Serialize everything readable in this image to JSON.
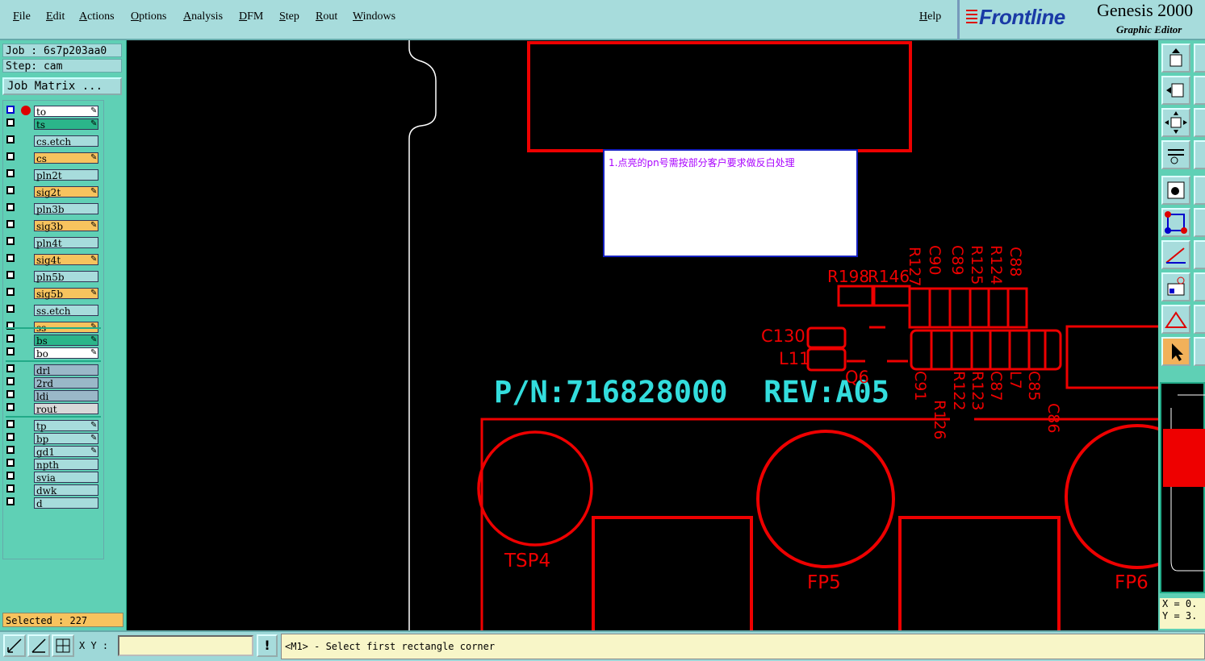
{
  "menu": {
    "items": [
      "File",
      "Edit",
      "Actions",
      "Options",
      "Analysis",
      "DFM",
      "Step",
      "Rout",
      "Windows"
    ],
    "help": "Help"
  },
  "brand": {
    "logo": "Frontline",
    "product": "Genesis 2000",
    "subtitle": "Graphic Editor"
  },
  "job": {
    "job": "Job  :  6s7p203aa0",
    "step": "Step: cam",
    "matrix_button": "Job Matrix ..."
  },
  "layers": [
    {
      "name": "to",
      "color": "#ffffff",
      "pen": true
    },
    {
      "name": "ts",
      "color": "#2bb58a",
      "pen": true
    },
    {
      "name": "cs.etch",
      "color": "#a7dcdc",
      "pen": false
    },
    {
      "name": "cs",
      "color": "#f7c35e",
      "pen": true
    },
    {
      "name": "pln2t",
      "color": "#a7dcdc",
      "pen": false
    },
    {
      "name": "sig2t",
      "color": "#f7c35e",
      "pen": true
    },
    {
      "name": "pln3b",
      "color": "#a7dcdc",
      "pen": false
    },
    {
      "name": "sig3b",
      "color": "#f7c35e",
      "pen": true
    },
    {
      "name": "pln4t",
      "color": "#a7dcdc",
      "pen": false
    },
    {
      "name": "sig4t",
      "color": "#f7c35e",
      "pen": true
    },
    {
      "name": "pln5b",
      "color": "#a7dcdc",
      "pen": false
    },
    {
      "name": "sig5b",
      "color": "#f7c35e",
      "pen": true
    },
    {
      "name": "ss.etch",
      "color": "#a7dcdc",
      "pen": false
    },
    {
      "name": "ss",
      "color": "#f7c35e",
      "pen": true
    },
    {
      "name": "bs",
      "color": "#2bb58a",
      "pen": true
    },
    {
      "name": "bo",
      "color": "#ffffff",
      "pen": true
    },
    {
      "name": "drl",
      "color": "#9ab8c8",
      "pen": false
    },
    {
      "name": "2rd",
      "color": "#9ab8c8",
      "pen": false
    },
    {
      "name": "ldi",
      "color": "#9ab8c8",
      "pen": false
    },
    {
      "name": "rout",
      "color": "#d8d8d8",
      "pen": false
    },
    {
      "name": "tp",
      "color": "#a7dcdc",
      "pen": true
    },
    {
      "name": "bp",
      "color": "#a7dcdc",
      "pen": true
    },
    {
      "name": "gd1",
      "color": "#a7dcdc",
      "pen": true
    },
    {
      "name": "npth",
      "color": "#a7dcdc",
      "pen": false
    },
    {
      "name": "svia",
      "color": "#a7dcdc",
      "pen": false
    },
    {
      "name": "dwk",
      "color": "#a7dcdc",
      "pen": false
    },
    {
      "name": "d",
      "color": "#a7dcdc",
      "pen": false
    }
  ],
  "selected": "Selected : 227",
  "canvas": {
    "note": "1.点亮的pn号需按部分客户要求做反白处理",
    "pn_text": "P/N:716828000  REV:A05",
    "labels": [
      "R198",
      "R146",
      "C130",
      "L11",
      "Q6",
      "TSP4",
      "FP5",
      "FP6"
    ],
    "vertical_labels_top": [
      "R127",
      "C90",
      "C89",
      "R125",
      "R124",
      "C88"
    ],
    "vertical_labels_bottom": [
      "C91",
      "R126",
      "R122",
      "R123",
      "C87",
      "L7",
      "C85",
      "C86"
    ]
  },
  "xy_readout": {
    "x": "X = 0.",
    "y": "Y = 3."
  },
  "statusbar": {
    "xy_label": "X Y :",
    "xy_value": "",
    "warn_label": "!",
    "message": "<M1> - Select first rectangle corner"
  },
  "colors": {
    "board": "#ee0000",
    "pn_text": "#33dddd",
    "note_text": "#aa00ff"
  }
}
